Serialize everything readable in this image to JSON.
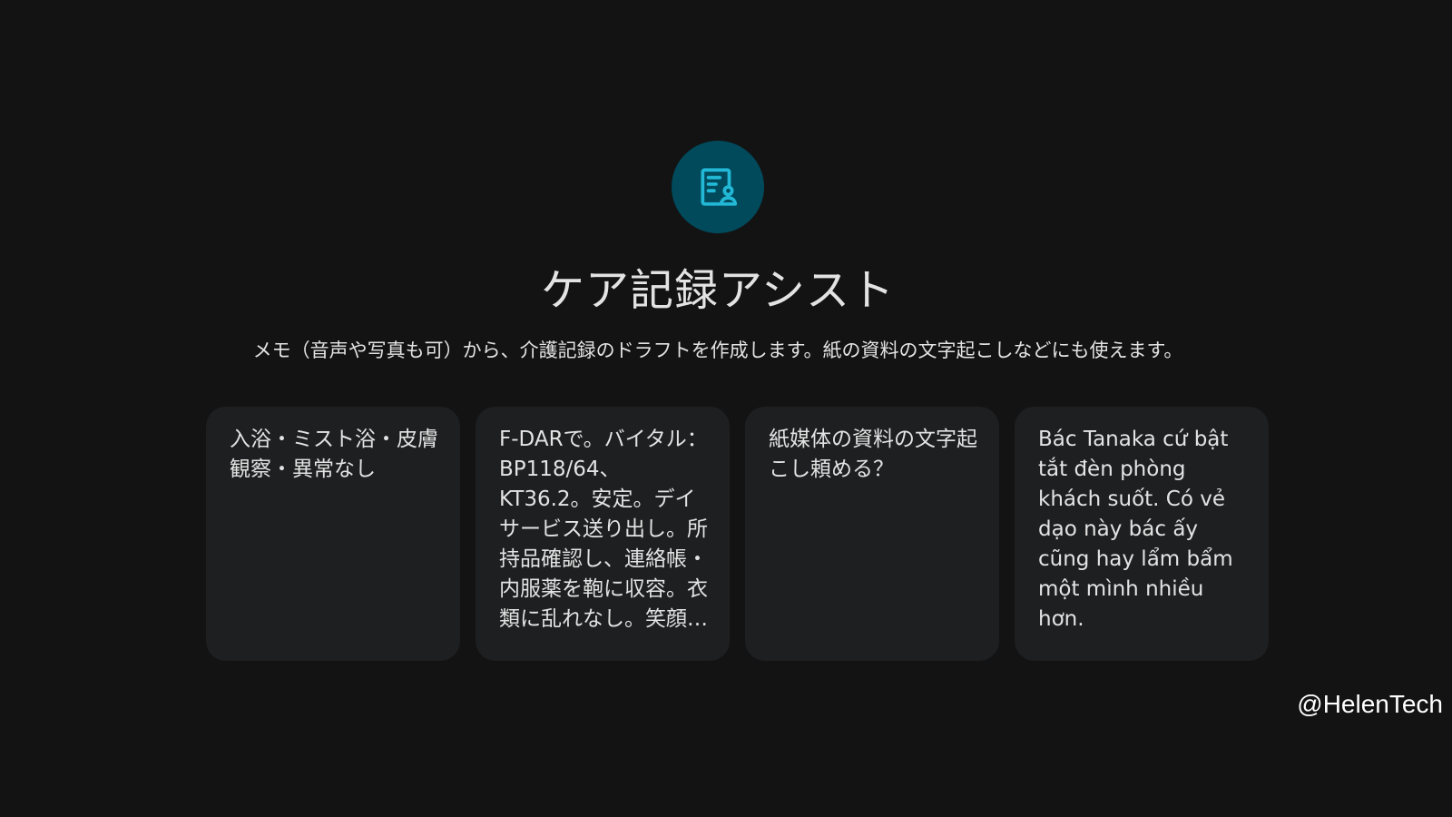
{
  "app": {
    "icon": "care-record-icon",
    "accent_color": "#004a5c",
    "icon_color": "#22b8d6",
    "title": "ケア記録アシスト",
    "description": "メモ（音声や写真も可）から、介護記録のドラフトを作成します。紙の資料の文字起こしなどにも使えます。"
  },
  "suggestions": [
    {
      "text": "入浴・ミスト浴・皮膚観察・異常なし"
    },
    {
      "text": "F-DARで。バイタル：BP118/64、KT36.2。安定。デイサービス送り出し。所持品確認し、連絡帳・内服薬を鞄に収容。衣類に乱れなし。笑顔で…"
    },
    {
      "text": "紙媒体の資料の文字起こし頼める？"
    },
    {
      "text": "Bác Tanaka cứ bật tắt đèn phòng khách suốt. Có vẻ dạo này bác ấy cũng hay lẩm bẩm một mình nhiều hơn."
    }
  ],
  "watermark": "@HelenTech"
}
